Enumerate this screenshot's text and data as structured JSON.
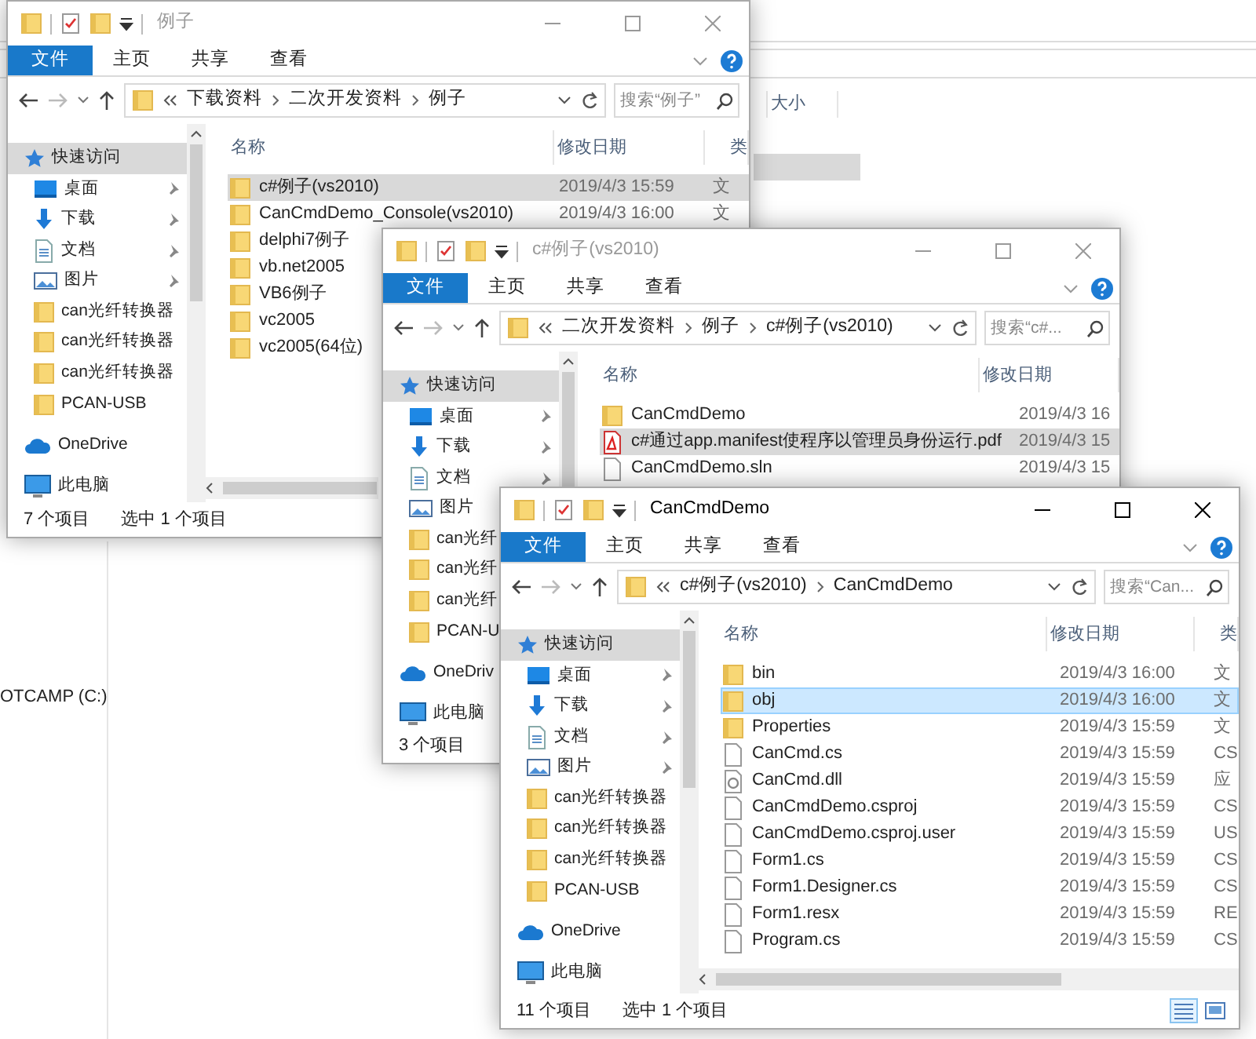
{
  "background_window": {
    "column_header": "大小",
    "drive_label": "OTCAMP (C:)"
  },
  "windows": [
    {
      "title": "例子",
      "active": false,
      "tabs": [
        {
          "label": "文件",
          "kind": "file"
        },
        {
          "label": "主页",
          "kind": "tab"
        },
        {
          "label": "共享",
          "kind": "tab"
        },
        {
          "label": "查看",
          "kind": "tab"
        }
      ],
      "breadcrumbs": [
        "下载资料",
        "二次开发资料",
        "例子"
      ],
      "search": {
        "placeholder": "搜索“例子”"
      },
      "columns": [
        "名称",
        "修改日期",
        "类"
      ],
      "nav": [
        {
          "label": "快速访问",
          "kind": "star",
          "selected": true,
          "pinned": false
        },
        {
          "label": "桌面",
          "kind": "desktop",
          "selected": false,
          "pinned": true
        },
        {
          "label": "下载",
          "kind": "download",
          "selected": false,
          "pinned": true
        },
        {
          "label": "文档",
          "kind": "doc",
          "selected": false,
          "pinned": true
        },
        {
          "label": "图片",
          "kind": "picture",
          "selected": false,
          "pinned": true
        },
        {
          "label": "can光纤转换器",
          "kind": "folder",
          "selected": false,
          "pinned": false
        },
        {
          "label": "can光纤转换器",
          "kind": "folder",
          "selected": false,
          "pinned": false
        },
        {
          "label": "can光纤转换器",
          "kind": "folder",
          "selected": false,
          "pinned": false
        },
        {
          "label": "PCAN-USB",
          "kind": "folder",
          "selected": false,
          "pinned": false
        },
        {
          "label": "OneDrive",
          "kind": "onedrive",
          "selected": false,
          "pinned": false
        },
        {
          "label": "此电脑",
          "kind": "pc",
          "selected": false,
          "pinned": false
        }
      ],
      "files": [
        {
          "name": "c#例子(vs2010)",
          "kind": "folder",
          "date": "2019/4/3 15:59",
          "type": "文",
          "selected": true
        },
        {
          "name": "CanCmdDemo_Console(vs2010)",
          "kind": "folder",
          "date": "2019/4/3 16:00",
          "type": "文",
          "selected": false
        },
        {
          "name": "delphi7例子",
          "kind": "folder",
          "selected": false
        },
        {
          "name": "vb.net2005",
          "kind": "folder",
          "selected": false
        },
        {
          "name": "VB6例子",
          "kind": "folder",
          "selected": false
        },
        {
          "name": "vc2005",
          "kind": "folder",
          "selected": false
        },
        {
          "name": "vc2005(64位)",
          "kind": "folder",
          "selected": false
        }
      ],
      "status": {
        "count": "7 个项目",
        "selection": "选中 1 个项目"
      }
    },
    {
      "title": "c#例子(vs2010)",
      "active": false,
      "tabs": [
        {
          "label": "文件",
          "kind": "file"
        },
        {
          "label": "主页",
          "kind": "tab"
        },
        {
          "label": "共享",
          "kind": "tab"
        },
        {
          "label": "查看",
          "kind": "tab"
        }
      ],
      "breadcrumbs": [
        "二次开发资料",
        "例子",
        "c#例子(vs2010)"
      ],
      "search": {
        "placeholder": "搜索“c#..."
      },
      "columns": [
        "名称",
        "修改日期"
      ],
      "nav": [
        {
          "label": "快速访问",
          "kind": "star",
          "selected": true,
          "pinned": false
        },
        {
          "label": "桌面",
          "kind": "desktop",
          "selected": false,
          "pinned": true
        },
        {
          "label": "下载",
          "kind": "download",
          "selected": false,
          "pinned": true
        },
        {
          "label": "文档",
          "kind": "doc",
          "selected": false,
          "pinned": true
        },
        {
          "label": "图片",
          "kind": "picture",
          "selected": false,
          "pinned": false
        },
        {
          "label": "can光纤",
          "kind": "folder",
          "selected": false,
          "pinned": false
        },
        {
          "label": "can光纤",
          "kind": "folder",
          "selected": false,
          "pinned": false
        },
        {
          "label": "can光纤",
          "kind": "folder",
          "selected": false,
          "pinned": false
        },
        {
          "label": "PCAN-U",
          "kind": "folder",
          "selected": false,
          "pinned": false
        },
        {
          "label": "OneDriv",
          "kind": "onedrive",
          "selected": false,
          "pinned": false
        },
        {
          "label": "此电脑",
          "kind": "pc",
          "selected": false,
          "pinned": false
        }
      ],
      "files": [
        {
          "name": "CanCmdDemo",
          "kind": "folder",
          "date": "2019/4/3 16",
          "selected": false
        },
        {
          "name": "c#通过app.manifest使程序以管理员身份运行.pdf",
          "kind": "pdf",
          "date": "2019/4/3 15",
          "selected": true
        },
        {
          "name": "CanCmdDemo.sln",
          "kind": "file",
          "date": "2019/4/3 15",
          "selected": false
        }
      ],
      "status": {
        "count": "3 个项目"
      }
    },
    {
      "title": "CanCmdDemo",
      "active": true,
      "tabs": [
        {
          "label": "文件",
          "kind": "file"
        },
        {
          "label": "主页",
          "kind": "tab"
        },
        {
          "label": "共享",
          "kind": "tab"
        },
        {
          "label": "查看",
          "kind": "tab"
        }
      ],
      "breadcrumbs": [
        "c#例子(vs2010)",
        "CanCmdDemo"
      ],
      "search": {
        "placeholder": "搜索“Can..."
      },
      "columns": [
        "名称",
        "修改日期",
        "类"
      ],
      "nav": [
        {
          "label": "快速访问",
          "kind": "star",
          "selected": true,
          "pinned": false
        },
        {
          "label": "桌面",
          "kind": "desktop",
          "selected": false,
          "pinned": true
        },
        {
          "label": "下载",
          "kind": "download",
          "selected": false,
          "pinned": true
        },
        {
          "label": "文档",
          "kind": "doc",
          "selected": false,
          "pinned": true
        },
        {
          "label": "图片",
          "kind": "picture",
          "selected": false,
          "pinned": true
        },
        {
          "label": "can光纤转换器",
          "kind": "folder",
          "selected": false,
          "pinned": false
        },
        {
          "label": "can光纤转换器",
          "kind": "folder",
          "selected": false,
          "pinned": false
        },
        {
          "label": "can光纤转换器",
          "kind": "folder",
          "selected": false,
          "pinned": false
        },
        {
          "label": "PCAN-USB",
          "kind": "folder",
          "selected": false,
          "pinned": false
        },
        {
          "label": "OneDrive",
          "kind": "onedrive",
          "selected": false,
          "pinned": false
        },
        {
          "label": "此电脑",
          "kind": "pc",
          "selected": false,
          "pinned": false
        }
      ],
      "files": [
        {
          "name": "bin",
          "kind": "folder",
          "date": "2019/4/3 16:00",
          "type": "文",
          "selected": false
        },
        {
          "name": "obj",
          "kind": "folder",
          "date": "2019/4/3 16:00",
          "type": "文",
          "selected": true
        },
        {
          "name": "Properties",
          "kind": "folder",
          "date": "2019/4/3 15:59",
          "type": "文",
          "selected": false
        },
        {
          "name": "CanCmd.cs",
          "kind": "file",
          "date": "2019/4/3 15:59",
          "type": "CS",
          "selected": false
        },
        {
          "name": "CanCmd.dll",
          "kind": "dll",
          "date": "2019/4/3 15:59",
          "type": "应",
          "selected": false
        },
        {
          "name": "CanCmdDemo.csproj",
          "kind": "file",
          "date": "2019/4/3 15:59",
          "type": "CS",
          "selected": false
        },
        {
          "name": "CanCmdDemo.csproj.user",
          "kind": "file",
          "date": "2019/4/3 15:59",
          "type": "US",
          "selected": false
        },
        {
          "name": "Form1.cs",
          "kind": "file",
          "date": "2019/4/3 15:59",
          "type": "CS",
          "selected": false
        },
        {
          "name": "Form1.Designer.cs",
          "kind": "file",
          "date": "2019/4/3 15:59",
          "type": "CS",
          "selected": false
        },
        {
          "name": "Form1.resx",
          "kind": "file",
          "date": "2019/4/3 15:59",
          "type": "RE",
          "selected": false
        },
        {
          "name": "Program.cs",
          "kind": "file",
          "date": "2019/4/3 15:59",
          "type": "CS",
          "selected": false
        }
      ],
      "status": {
        "count": "11 个项目",
        "selection": "选中 1 个项目"
      }
    }
  ]
}
